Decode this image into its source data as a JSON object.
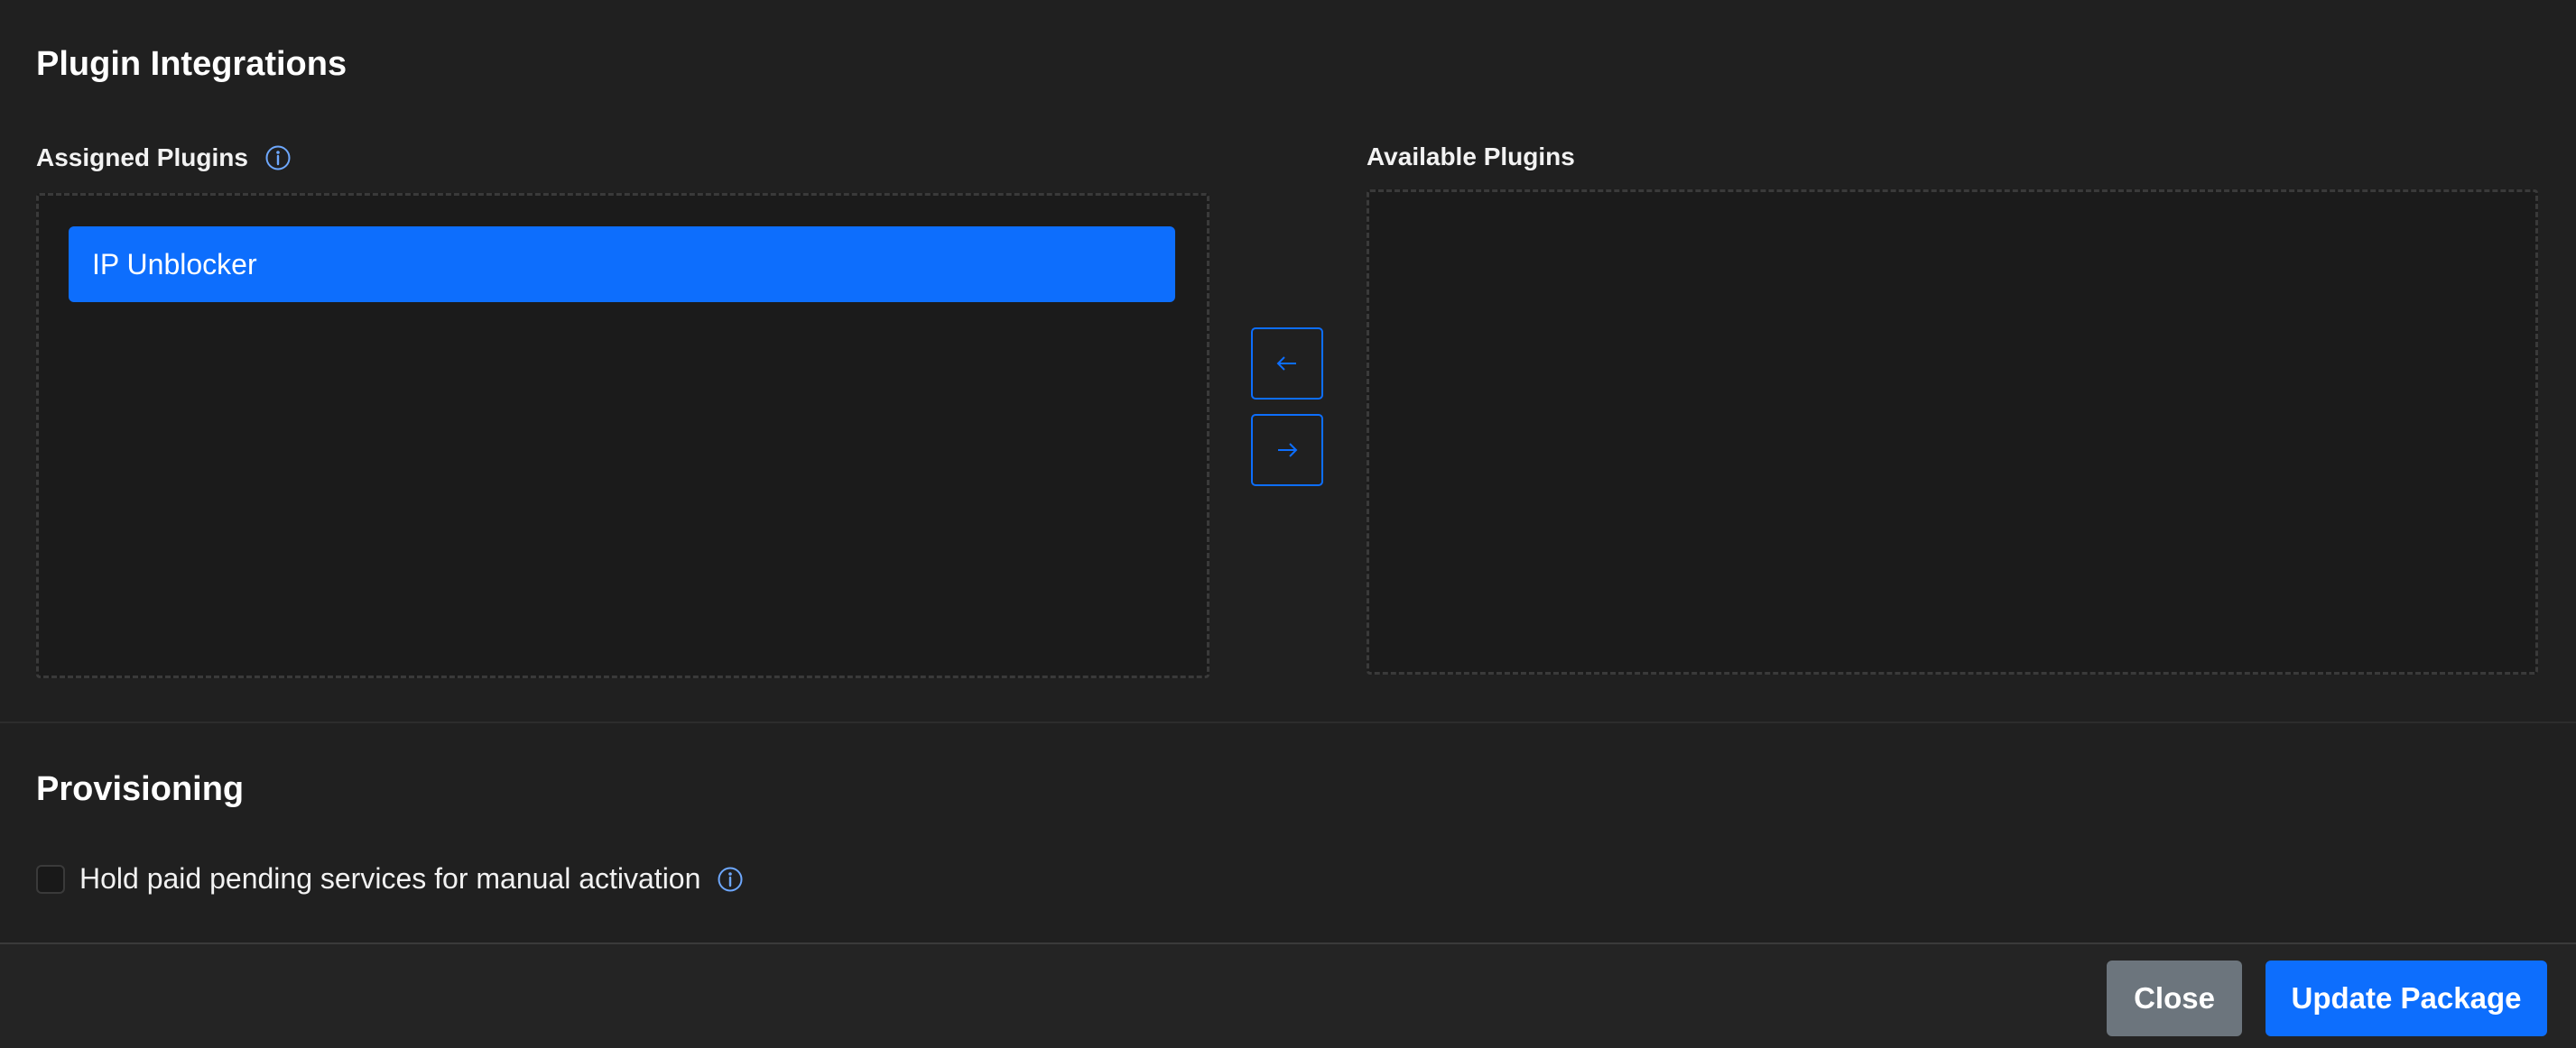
{
  "plugin_integrations": {
    "title": "Plugin Integrations",
    "assigned": {
      "label": "Assigned Plugins",
      "items": [
        "IP Unblocker"
      ]
    },
    "available": {
      "label": "Available Plugins",
      "items": []
    },
    "move_left_icon": "arrow-left-icon",
    "move_right_icon": "arrow-right-icon"
  },
  "provisioning": {
    "title": "Provisioning",
    "hold_pending": {
      "label": "Hold paid pending services for manual activation",
      "checked": false
    }
  },
  "footer": {
    "close_label": "Close",
    "update_label": "Update Package"
  },
  "colors": {
    "accent": "#0d6efd",
    "secondary": "#6c757d",
    "background": "#202020",
    "info_icon": "#6ea8fe"
  }
}
